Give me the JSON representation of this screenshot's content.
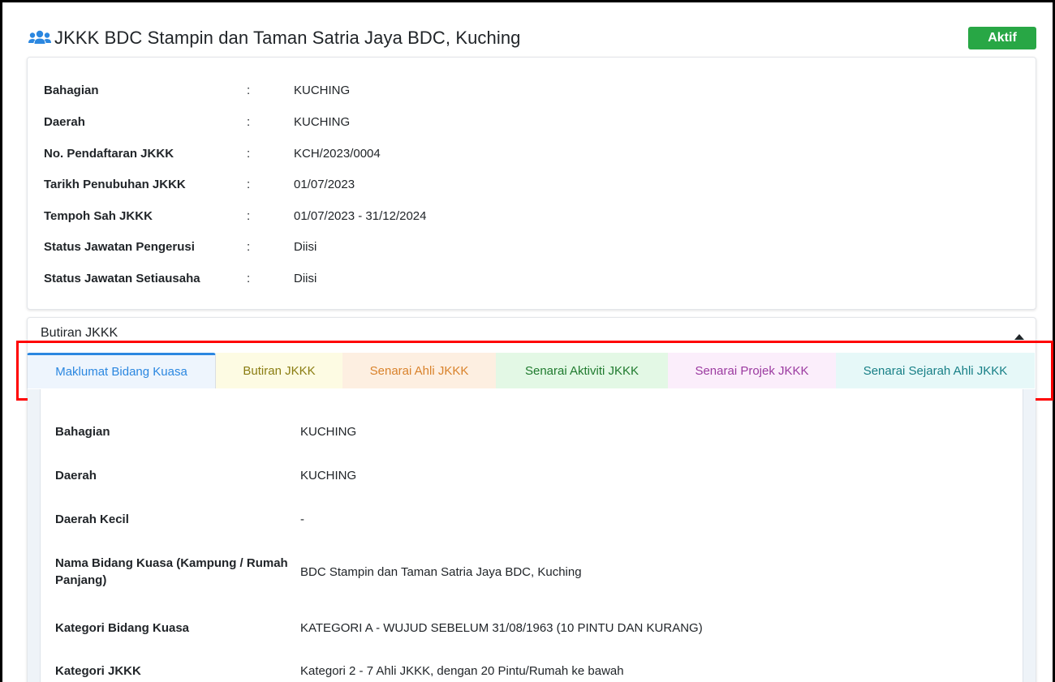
{
  "header": {
    "title": "JKKK BDC Stampin dan Taman Satria Jaya BDC, Kuching",
    "status": "Aktif",
    "icon": "users-icon",
    "icon_color": "#2b87e0",
    "status_color": "#28a745"
  },
  "info": {
    "separator": ":",
    "rows": [
      {
        "label": "Bahagian",
        "value": "KUCHING"
      },
      {
        "label": "Daerah",
        "value": "KUCHING"
      },
      {
        "label": "No. Pendaftaran JKKK",
        "value": "KCH/2023/0004"
      },
      {
        "label": "Tarikh Penubuhan JKKK",
        "value": "01/07/2023"
      },
      {
        "label": "Tempoh Sah JKKK",
        "value": "01/07/2023 - 31/12/2024"
      },
      {
        "label": "Status Jawatan Pengerusi",
        "value": "Diisi"
      },
      {
        "label": "Status Jawatan Setiausaha",
        "value": "Diisi"
      }
    ]
  },
  "butiran": {
    "heading": "Butiran JKKK",
    "tabs": [
      {
        "label": "Maklumat Bidang Kuasa",
        "active": true,
        "color": "#2b87e0",
        "bg": "#eef5fd"
      },
      {
        "label": "Butiran JKKK",
        "active": false,
        "color": "#8a7d12",
        "bg": "#fdfbe3"
      },
      {
        "label": "Senarai Ahli JKKK",
        "active": false,
        "color": "#d9822b",
        "bg": "#fdefe1"
      },
      {
        "label": "Senarai Aktiviti JKKK",
        "active": false,
        "color": "#1f7a2e",
        "bg": "#e3f8e5"
      },
      {
        "label": "Senarai Projek JKKK",
        "active": false,
        "color": "#9b3aa0",
        "bg": "#fbeefb"
      },
      {
        "label": "Senarai Sejarah Ahli JKKK",
        "active": false,
        "color": "#177f86",
        "bg": "#e6f8f8"
      }
    ],
    "details": [
      {
        "label": "Bahagian",
        "value": "KUCHING"
      },
      {
        "label": "Daerah",
        "value": "KUCHING"
      },
      {
        "label": "Daerah Kecil",
        "value": "-"
      },
      {
        "label": "Nama Bidang Kuasa (Kampung / Rumah Panjang)",
        "value": "BDC Stampin dan Taman Satria Jaya BDC, Kuching"
      },
      {
        "label": "Kategori Bidang Kuasa",
        "value": "KATEGORI A - WUJUD SEBELUM 31/08/1963 (10 PINTU DAN KURANG)"
      },
      {
        "label": "Kategori JKKK",
        "value": "Kategori 2 - 7 Ahli JKKK, dengan 20 Pintu/Rumah ke bawah"
      }
    ]
  }
}
